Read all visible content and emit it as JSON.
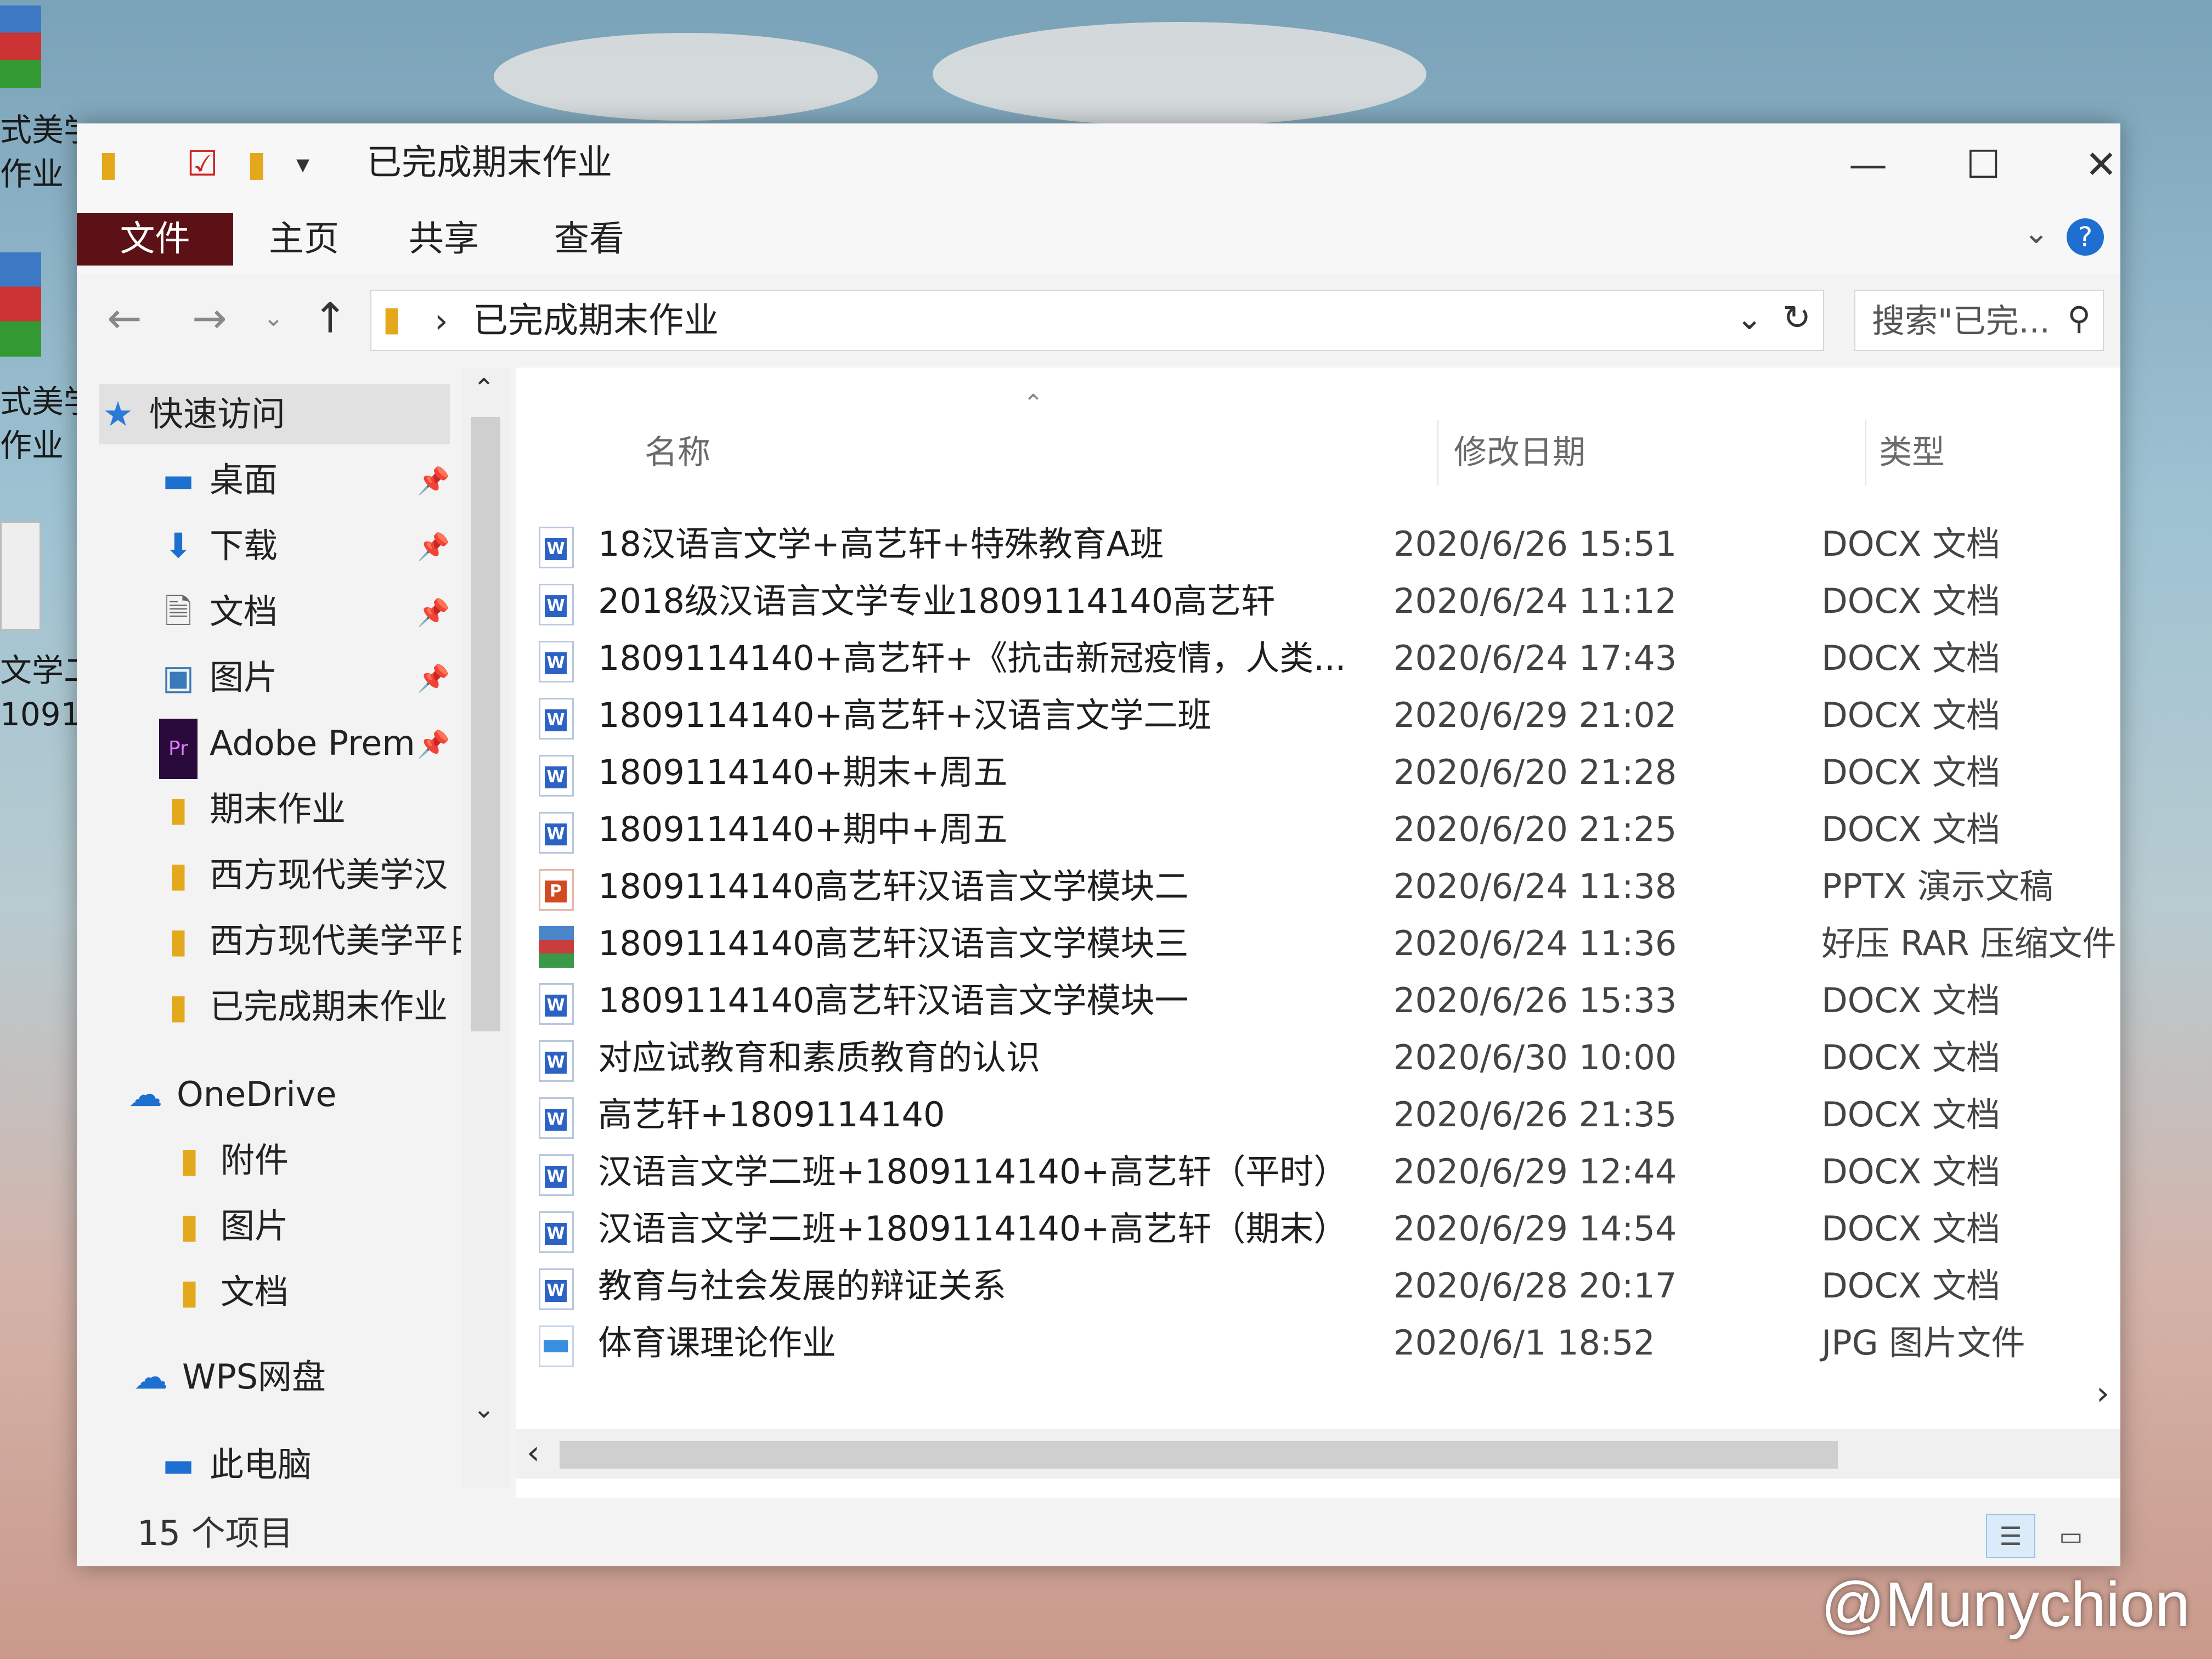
{
  "desktop": {
    "labels": [
      "式美学",
      "作业",
      "式美学",
      "作业",
      "文学二",
      "1091..."
    ]
  },
  "window": {
    "title": "已完成期末作业",
    "controls": {
      "minimize": "—",
      "maximize": "☐",
      "close": "✕"
    }
  },
  "ribbon": {
    "tabs": [
      "文件",
      "主页",
      "共享",
      "查看"
    ],
    "help": "?"
  },
  "address": {
    "crumb_separator": "›",
    "path": "已完成期末作业",
    "search_placeholder": "搜索\"已完..."
  },
  "sidebar": {
    "quick_access": "快速访问",
    "pinned": [
      {
        "label": "桌面",
        "icon": "desktop-icon"
      },
      {
        "label": "下载",
        "icon": "download-icon"
      },
      {
        "label": "文档",
        "icon": "document-icon"
      },
      {
        "label": "图片",
        "icon": "picture-icon"
      },
      {
        "label": "Adobe Prem",
        "icon": "premiere-icon"
      }
    ],
    "folders": [
      "期末作业",
      "西方现代美学汉",
      "西方现代美学平日",
      "已完成期末作业"
    ],
    "onedrive": "OneDrive",
    "onedrive_items": [
      "附件",
      "图片",
      "文档"
    ],
    "wps": "WPS网盘",
    "this_pc": "此电脑"
  },
  "columns": {
    "name": "名称",
    "date": "修改日期",
    "type": "类型"
  },
  "files": [
    {
      "name": "18汉语言文学+高艺轩+特殊教育A班",
      "date": "2020/6/26 15:51",
      "type": "DOCX 文档",
      "icon": "word"
    },
    {
      "name": "2018级汉语言文学专业1809114140高艺轩",
      "date": "2020/6/24 11:12",
      "type": "DOCX 文档",
      "icon": "word"
    },
    {
      "name": "1809114140+高艺轩+《抗击新冠疫情，人类...",
      "date": "2020/6/24 17:43",
      "type": "DOCX 文档",
      "icon": "word"
    },
    {
      "name": "1809114140+高艺轩+汉语言文学二班",
      "date": "2020/6/29 21:02",
      "type": "DOCX 文档",
      "icon": "word"
    },
    {
      "name": "1809114140+期末+周五",
      "date": "2020/6/20 21:28",
      "type": "DOCX 文档",
      "icon": "word"
    },
    {
      "name": "1809114140+期中+周五",
      "date": "2020/6/20 21:25",
      "type": "DOCX 文档",
      "icon": "word"
    },
    {
      "name": "1809114140高艺轩汉语言文学模块二",
      "date": "2020/6/24 11:38",
      "type": "PPTX 演示文稿",
      "icon": "ppt"
    },
    {
      "name": "1809114140高艺轩汉语言文学模块三",
      "date": "2020/6/24 11:36",
      "type": "好压 RAR 压缩文件",
      "icon": "rar"
    },
    {
      "name": "1809114140高艺轩汉语言文学模块一",
      "date": "2020/6/26 15:33",
      "type": "DOCX 文档",
      "icon": "word"
    },
    {
      "name": "对应试教育和素质教育的认识",
      "date": "2020/6/30 10:00",
      "type": "DOCX 文档",
      "icon": "word"
    },
    {
      "name": "高艺轩+1809114140",
      "date": "2020/6/26 21:35",
      "type": "DOCX 文档",
      "icon": "word"
    },
    {
      "name": "汉语言文学二班+1809114140+高艺轩（平时）",
      "date": "2020/6/29 12:44",
      "type": "DOCX 文档",
      "icon": "word"
    },
    {
      "name": "汉语言文学二班+1809114140+高艺轩（期末）",
      "date": "2020/6/29 14:54",
      "type": "DOCX 文档",
      "icon": "word"
    },
    {
      "name": "教育与社会发展的辩证关系",
      "date": "2020/6/28 20:17",
      "type": "DOCX 文档",
      "icon": "word"
    },
    {
      "name": "体育课理论作业",
      "date": "2020/6/1 18:52",
      "type": "JPG 图片文件",
      "icon": "jpg"
    }
  ],
  "status": {
    "item_count": "15 个项目"
  },
  "watermark": "@Munychion"
}
